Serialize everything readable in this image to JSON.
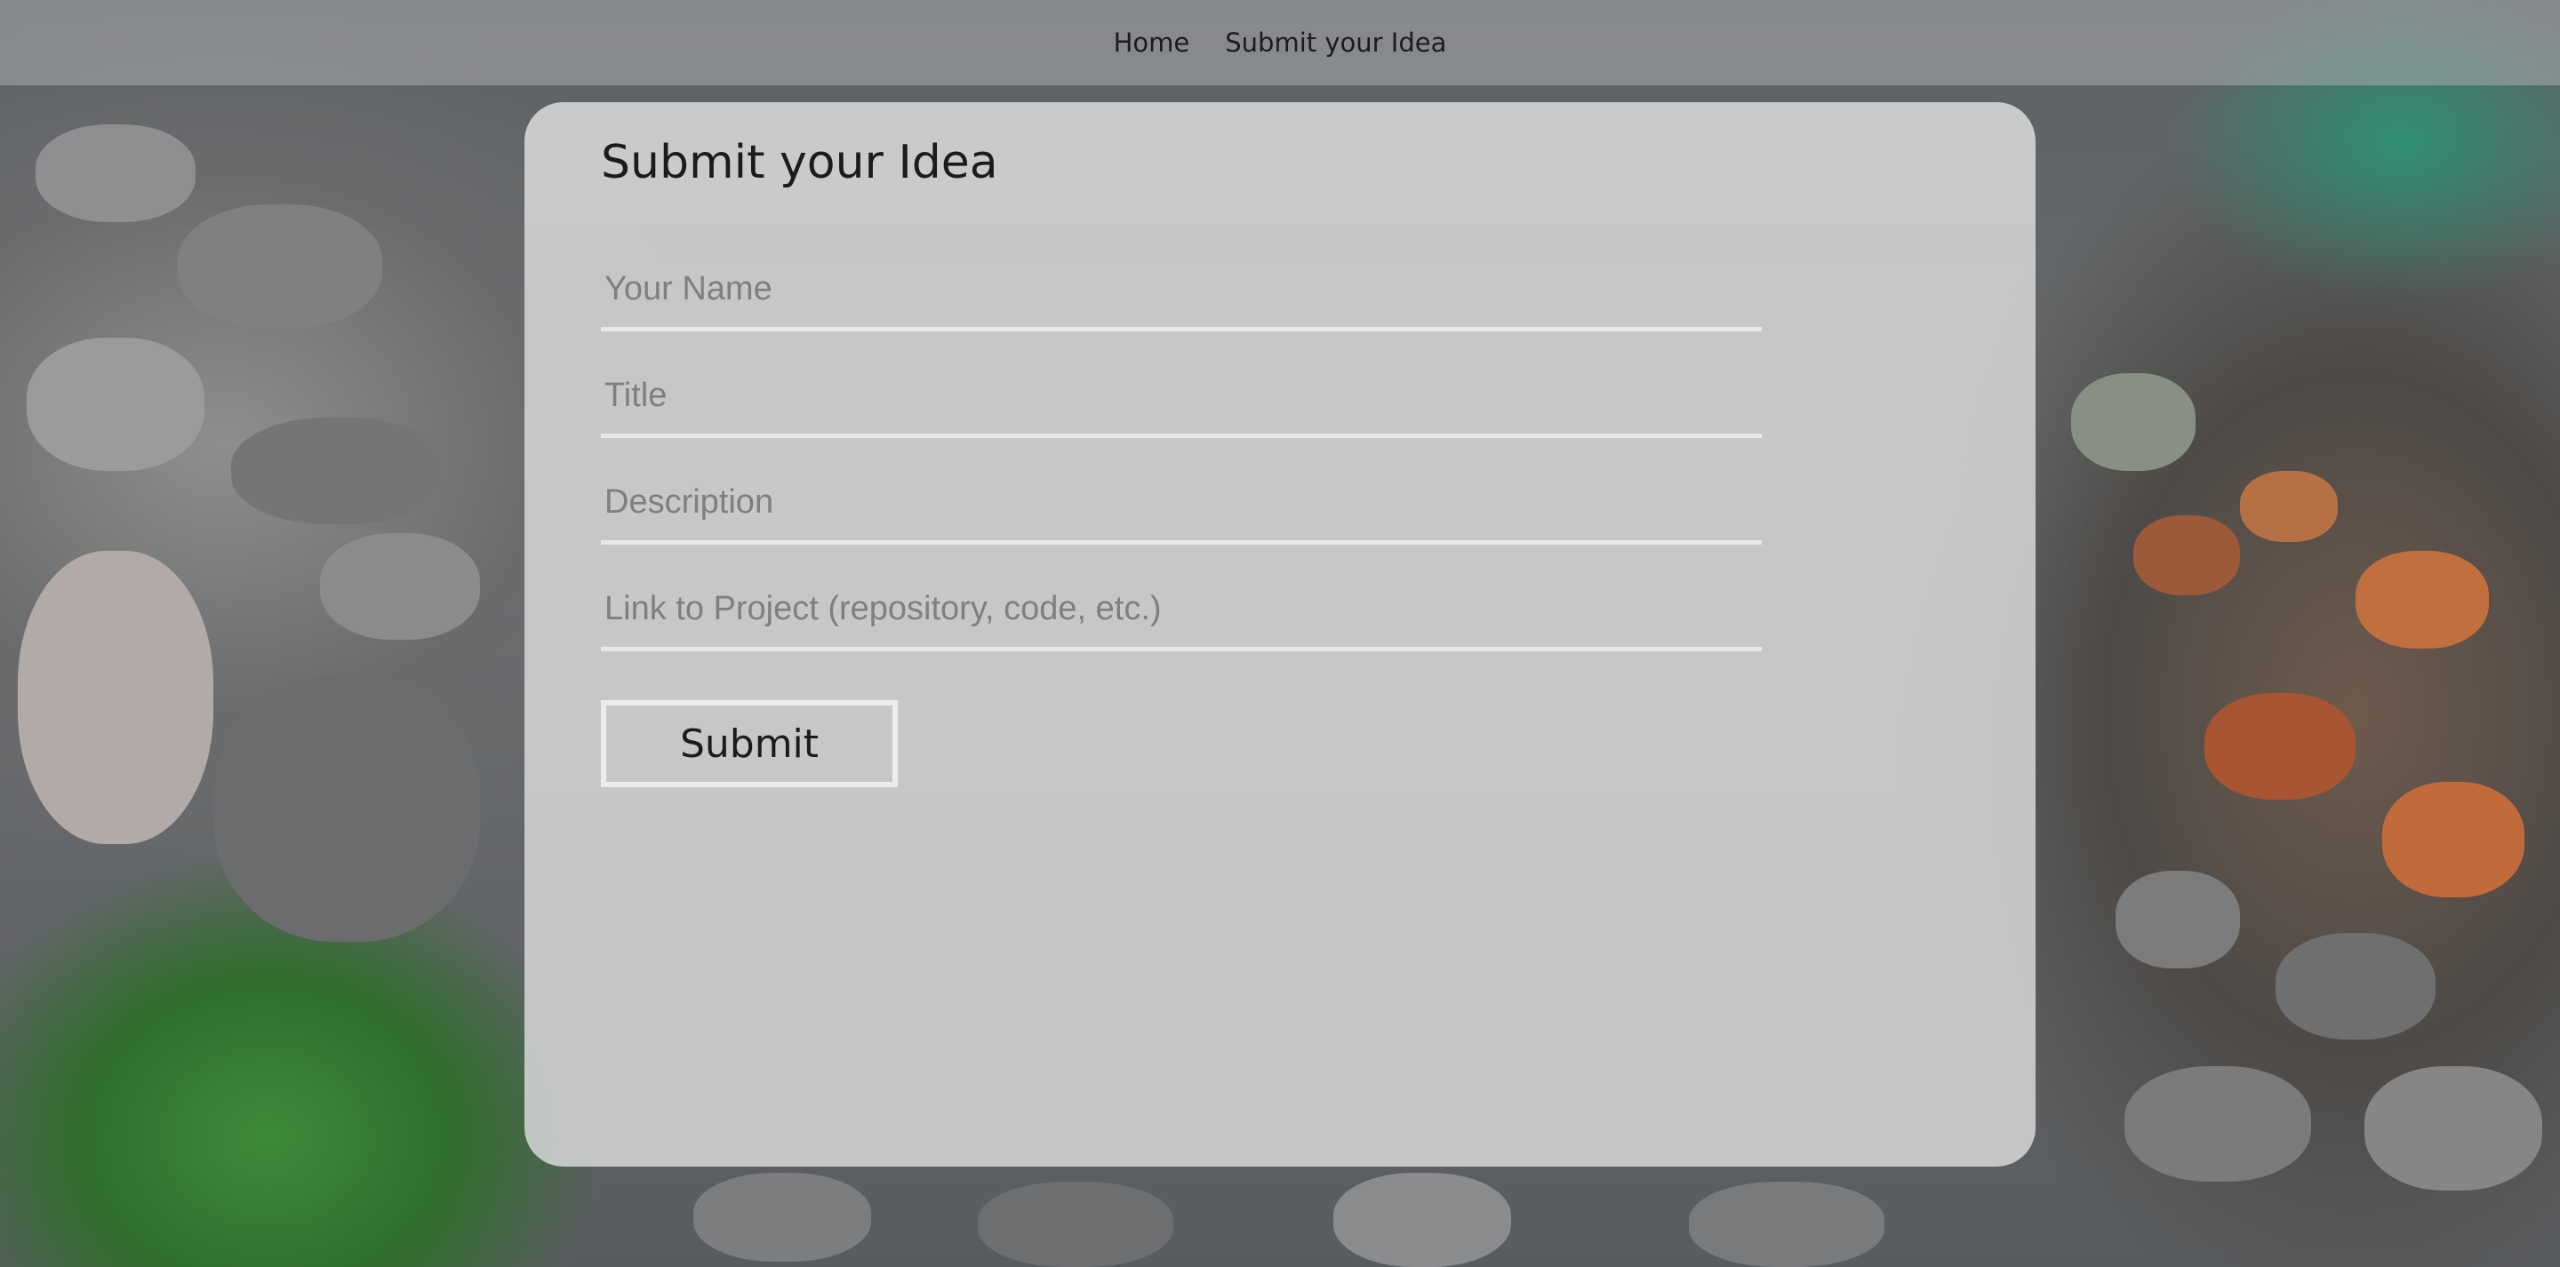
{
  "nav": {
    "items": [
      {
        "label": "Home"
      },
      {
        "label": "Submit your Idea"
      }
    ]
  },
  "card": {
    "title": "Submit your Idea"
  },
  "form": {
    "name_placeholder": "Your Name",
    "title_placeholder": "Title",
    "description_placeholder": "Description",
    "link_placeholder": "Link to Project (repository, code, etc.)",
    "submit_label": "Submit"
  }
}
